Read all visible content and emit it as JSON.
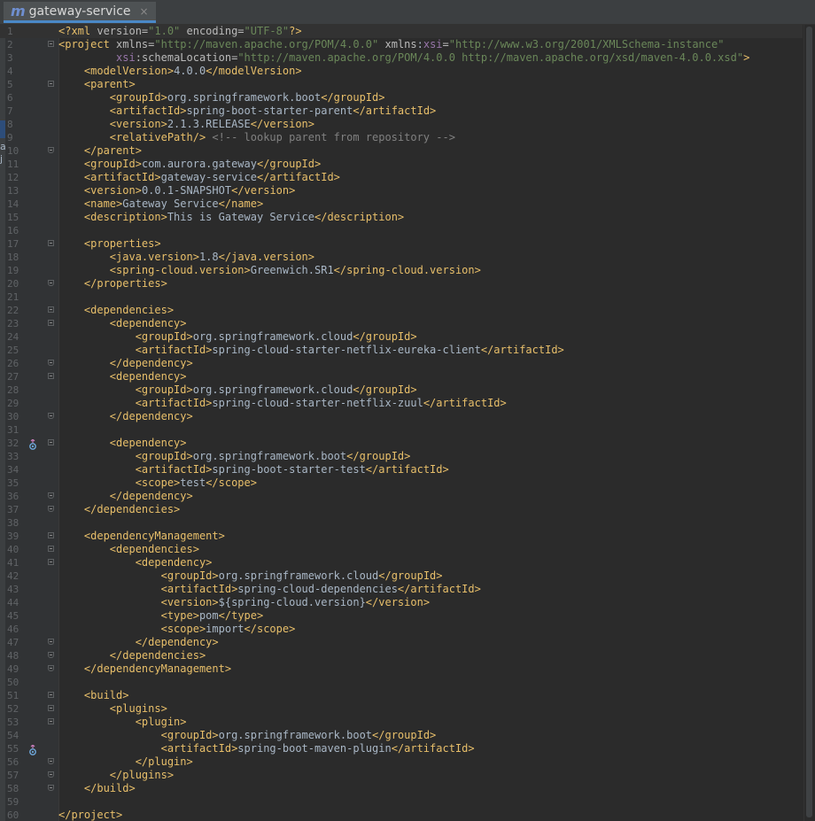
{
  "tab": {
    "icon_letter": "m",
    "title": "gateway-service",
    "close_glyph": "×"
  },
  "side_marks": {
    "top": "r",
    "mid1": "a",
    "mid2": "j"
  },
  "gutter_markers": {
    "line32": "run-icon",
    "line55": "run-icon"
  },
  "colors": {
    "tag": "#e8bf6a",
    "string": "#6a8759",
    "comment": "#808080",
    "text": "#a9b7c6",
    "namespace": "#9876aa"
  },
  "editor": {
    "lines": [
      {
        "n": "1",
        "segs": [
          [
            "t",
            "<?xml "
          ],
          [
            "a",
            "version="
          ],
          [
            "s",
            "\"1.0\""
          ],
          [
            "a",
            " encoding="
          ],
          [
            "s",
            "\"UTF-8\""
          ],
          [
            "t",
            "?>"
          ]
        ]
      },
      {
        "n": "2",
        "segs": [
          [
            "t",
            "<project "
          ],
          [
            "a",
            "xmlns="
          ],
          [
            "s",
            "\"http://maven.apache.org/POM/4.0.0\""
          ],
          [
            "a",
            " xmlns"
          ],
          [
            "x",
            ":"
          ],
          [
            "ns",
            "xsi"
          ],
          [
            "a",
            "="
          ],
          [
            "s",
            "\"http://www.w3.org/2001/XMLSchema-instance\""
          ]
        ]
      },
      {
        "n": "3",
        "segs": [
          [
            "x",
            "         "
          ],
          [
            "ns",
            "xsi"
          ],
          [
            "a",
            ":schemaLocation="
          ],
          [
            "s",
            "\"http://maven.apache.org/POM/4.0.0 http://maven.apache.org/xsd/maven-4.0.0.xsd\""
          ],
          [
            "t",
            ">"
          ]
        ]
      },
      {
        "n": "4",
        "segs": [
          [
            "x",
            "    "
          ],
          [
            "t",
            "<modelVersion>"
          ],
          [
            "x",
            "4.0.0"
          ],
          [
            "t",
            "</modelVersion>"
          ]
        ]
      },
      {
        "n": "5",
        "segs": [
          [
            "x",
            "    "
          ],
          [
            "t",
            "<parent>"
          ]
        ]
      },
      {
        "n": "6",
        "segs": [
          [
            "x",
            "        "
          ],
          [
            "t",
            "<groupId>"
          ],
          [
            "x",
            "org.springframework.boot"
          ],
          [
            "t",
            "</groupId>"
          ]
        ]
      },
      {
        "n": "7",
        "segs": [
          [
            "x",
            "        "
          ],
          [
            "t",
            "<artifactId>"
          ],
          [
            "x",
            "spring-boot-starter-parent"
          ],
          [
            "t",
            "</artifactId>"
          ]
        ]
      },
      {
        "n": "8",
        "segs": [
          [
            "x",
            "        "
          ],
          [
            "t",
            "<version>"
          ],
          [
            "x",
            "2.1.3.RELEASE"
          ],
          [
            "t",
            "</version>"
          ]
        ]
      },
      {
        "n": "9",
        "segs": [
          [
            "x",
            "        "
          ],
          [
            "t",
            "<relativePath/>"
          ],
          [
            "c",
            " <!-- lookup parent from repository -->"
          ]
        ]
      },
      {
        "n": "10",
        "segs": [
          [
            "x",
            "    "
          ],
          [
            "t",
            "</parent>"
          ]
        ]
      },
      {
        "n": "11",
        "segs": [
          [
            "x",
            "    "
          ],
          [
            "t",
            "<groupId>"
          ],
          [
            "x",
            "com.aurora.gateway"
          ],
          [
            "t",
            "</groupId>"
          ]
        ]
      },
      {
        "n": "12",
        "segs": [
          [
            "x",
            "    "
          ],
          [
            "t",
            "<artifactId>"
          ],
          [
            "x",
            "gateway-service"
          ],
          [
            "t",
            "</artifactId>"
          ]
        ]
      },
      {
        "n": "13",
        "segs": [
          [
            "x",
            "    "
          ],
          [
            "t",
            "<version>"
          ],
          [
            "x",
            "0.0.1-SNAPSHOT"
          ],
          [
            "t",
            "</version>"
          ]
        ]
      },
      {
        "n": "14",
        "segs": [
          [
            "x",
            "    "
          ],
          [
            "t",
            "<name>"
          ],
          [
            "x",
            "Gateway Service"
          ],
          [
            "t",
            "</name>"
          ]
        ]
      },
      {
        "n": "15",
        "segs": [
          [
            "x",
            "    "
          ],
          [
            "t",
            "<description>"
          ],
          [
            "x",
            "This is Gateway Service"
          ],
          [
            "t",
            "</description>"
          ]
        ]
      },
      {
        "n": "16",
        "segs": []
      },
      {
        "n": "17",
        "segs": [
          [
            "x",
            "    "
          ],
          [
            "t",
            "<properties>"
          ]
        ]
      },
      {
        "n": "18",
        "segs": [
          [
            "x",
            "        "
          ],
          [
            "t",
            "<java.version>"
          ],
          [
            "x",
            "1.8"
          ],
          [
            "t",
            "</java.version>"
          ]
        ]
      },
      {
        "n": "19",
        "segs": [
          [
            "x",
            "        "
          ],
          [
            "t",
            "<spring-cloud.version>"
          ],
          [
            "x",
            "Greenwich.SR1"
          ],
          [
            "t",
            "</spring-cloud.version>"
          ]
        ]
      },
      {
        "n": "20",
        "segs": [
          [
            "x",
            "    "
          ],
          [
            "t",
            "</properties>"
          ]
        ]
      },
      {
        "n": "21",
        "segs": []
      },
      {
        "n": "22",
        "segs": [
          [
            "x",
            "    "
          ],
          [
            "t",
            "<dependencies>"
          ]
        ]
      },
      {
        "n": "23",
        "segs": [
          [
            "x",
            "        "
          ],
          [
            "t",
            "<dependency>"
          ]
        ]
      },
      {
        "n": "24",
        "segs": [
          [
            "x",
            "            "
          ],
          [
            "t",
            "<groupId>"
          ],
          [
            "x",
            "org.springframework.cloud"
          ],
          [
            "t",
            "</groupId>"
          ]
        ]
      },
      {
        "n": "25",
        "segs": [
          [
            "x",
            "            "
          ],
          [
            "t",
            "<artifactId>"
          ],
          [
            "x",
            "spring-cloud-starter-netflix-eureka-client"
          ],
          [
            "t",
            "</artifactId>"
          ]
        ]
      },
      {
        "n": "26",
        "segs": [
          [
            "x",
            "        "
          ],
          [
            "t",
            "</dependency>"
          ]
        ]
      },
      {
        "n": "27",
        "segs": [
          [
            "x",
            "        "
          ],
          [
            "t",
            "<dependency>"
          ]
        ]
      },
      {
        "n": "28",
        "segs": [
          [
            "x",
            "            "
          ],
          [
            "t",
            "<groupId>"
          ],
          [
            "x",
            "org.springframework.cloud"
          ],
          [
            "t",
            "</groupId>"
          ]
        ]
      },
      {
        "n": "29",
        "segs": [
          [
            "x",
            "            "
          ],
          [
            "t",
            "<artifactId>"
          ],
          [
            "x",
            "spring-cloud-starter-netflix-zuul"
          ],
          [
            "t",
            "</artifactId>"
          ]
        ]
      },
      {
        "n": "30",
        "segs": [
          [
            "x",
            "        "
          ],
          [
            "t",
            "</dependency>"
          ]
        ]
      },
      {
        "n": "31",
        "segs": []
      },
      {
        "n": "32",
        "segs": [
          [
            "x",
            "        "
          ],
          [
            "t",
            "<dependency>"
          ]
        ]
      },
      {
        "n": "33",
        "segs": [
          [
            "x",
            "            "
          ],
          [
            "t",
            "<groupId>"
          ],
          [
            "x",
            "org.springframework.boot"
          ],
          [
            "t",
            "</groupId>"
          ]
        ]
      },
      {
        "n": "34",
        "segs": [
          [
            "x",
            "            "
          ],
          [
            "t",
            "<artifactId>"
          ],
          [
            "x",
            "spring-boot-starter-test"
          ],
          [
            "t",
            "</artifactId>"
          ]
        ]
      },
      {
        "n": "35",
        "segs": [
          [
            "x",
            "            "
          ],
          [
            "t",
            "<scope>"
          ],
          [
            "x",
            "test"
          ],
          [
            "t",
            "</scope>"
          ]
        ]
      },
      {
        "n": "36",
        "segs": [
          [
            "x",
            "        "
          ],
          [
            "t",
            "</dependency>"
          ]
        ]
      },
      {
        "n": "37",
        "segs": [
          [
            "x",
            "    "
          ],
          [
            "t",
            "</dependencies>"
          ]
        ]
      },
      {
        "n": "38",
        "segs": []
      },
      {
        "n": "39",
        "segs": [
          [
            "x",
            "    "
          ],
          [
            "t",
            "<dependencyManagement>"
          ]
        ]
      },
      {
        "n": "40",
        "segs": [
          [
            "x",
            "        "
          ],
          [
            "t",
            "<dependencies>"
          ]
        ]
      },
      {
        "n": "41",
        "segs": [
          [
            "x",
            "            "
          ],
          [
            "t",
            "<dependency>"
          ]
        ]
      },
      {
        "n": "42",
        "segs": [
          [
            "x",
            "                "
          ],
          [
            "t",
            "<groupId>"
          ],
          [
            "x",
            "org.springframework.cloud"
          ],
          [
            "t",
            "</groupId>"
          ]
        ]
      },
      {
        "n": "43",
        "segs": [
          [
            "x",
            "                "
          ],
          [
            "t",
            "<artifactId>"
          ],
          [
            "x",
            "spring-cloud-dependencies"
          ],
          [
            "t",
            "</artifactId>"
          ]
        ]
      },
      {
        "n": "44",
        "segs": [
          [
            "x",
            "                "
          ],
          [
            "t",
            "<version>"
          ],
          [
            "x",
            "${spring-cloud.version}"
          ],
          [
            "t",
            "</version>"
          ]
        ]
      },
      {
        "n": "45",
        "segs": [
          [
            "x",
            "                "
          ],
          [
            "t",
            "<type>"
          ],
          [
            "x",
            "pom"
          ],
          [
            "t",
            "</type>"
          ]
        ]
      },
      {
        "n": "46",
        "segs": [
          [
            "x",
            "                "
          ],
          [
            "t",
            "<scope>"
          ],
          [
            "x",
            "import"
          ],
          [
            "t",
            "</scope>"
          ]
        ]
      },
      {
        "n": "47",
        "segs": [
          [
            "x",
            "            "
          ],
          [
            "t",
            "</dependency>"
          ]
        ]
      },
      {
        "n": "48",
        "segs": [
          [
            "x",
            "        "
          ],
          [
            "t",
            "</dependencies>"
          ]
        ]
      },
      {
        "n": "49",
        "segs": [
          [
            "x",
            "    "
          ],
          [
            "t",
            "</dependencyManagement>"
          ]
        ]
      },
      {
        "n": "50",
        "segs": []
      },
      {
        "n": "51",
        "segs": [
          [
            "x",
            "    "
          ],
          [
            "t",
            "<build>"
          ]
        ]
      },
      {
        "n": "52",
        "segs": [
          [
            "x",
            "        "
          ],
          [
            "t",
            "<plugins>"
          ]
        ]
      },
      {
        "n": "53",
        "segs": [
          [
            "x",
            "            "
          ],
          [
            "t",
            "<plugin>"
          ]
        ]
      },
      {
        "n": "54",
        "segs": [
          [
            "x",
            "                "
          ],
          [
            "t",
            "<groupId>"
          ],
          [
            "x",
            "org.springframework.boot"
          ],
          [
            "t",
            "</groupId>"
          ]
        ]
      },
      {
        "n": "55",
        "segs": [
          [
            "x",
            "                "
          ],
          [
            "t",
            "<artifactId>"
          ],
          [
            "x",
            "spring-boot-maven-plugin"
          ],
          [
            "t",
            "</artifactId>"
          ]
        ]
      },
      {
        "n": "56",
        "segs": [
          [
            "x",
            "            "
          ],
          [
            "t",
            "</plugin>"
          ]
        ]
      },
      {
        "n": "57",
        "segs": [
          [
            "x",
            "        "
          ],
          [
            "t",
            "</plugins>"
          ]
        ]
      },
      {
        "n": "58",
        "segs": [
          [
            "x",
            "    "
          ],
          [
            "t",
            "</build>"
          ]
        ]
      },
      {
        "n": "59",
        "segs": []
      },
      {
        "n": "60",
        "segs": [
          [
            "t",
            "</project>"
          ]
        ]
      }
    ]
  }
}
